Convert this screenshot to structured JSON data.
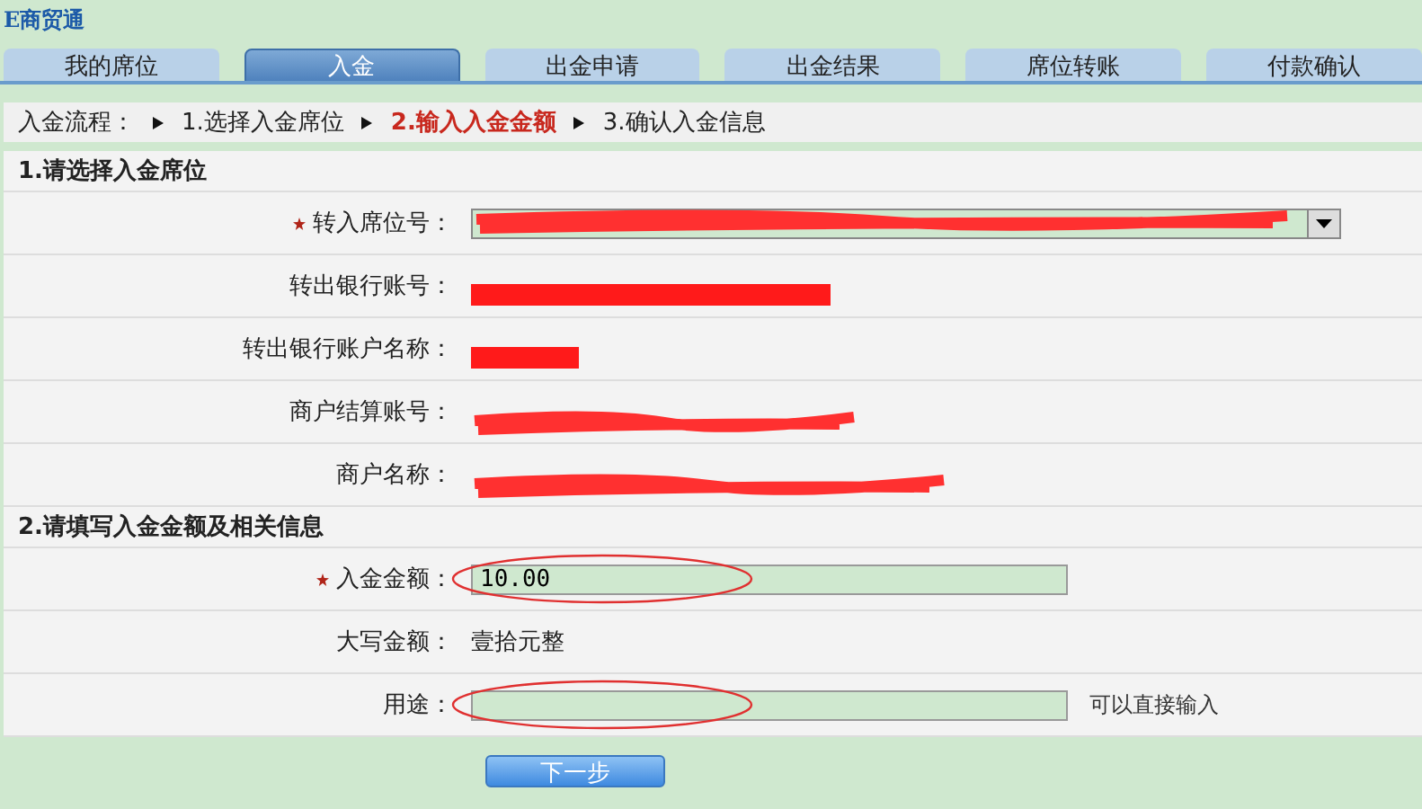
{
  "app_title": "E商贸通",
  "tabs": [
    {
      "label": "我的席位",
      "selected": false
    },
    {
      "label": "入金",
      "selected": true
    },
    {
      "label": "出金申请",
      "selected": false
    },
    {
      "label": "出金结果",
      "selected": false
    },
    {
      "label": "席位转账",
      "selected": false
    },
    {
      "label": "付款确认",
      "selected": false
    }
  ],
  "steps": {
    "label": "入金流程：",
    "items": [
      {
        "label": "1.选择入金席位",
        "selected": false
      },
      {
        "label": "2.输入入金金额",
        "selected": true
      },
      {
        "label": "3.确认入金信息",
        "selected": false
      }
    ]
  },
  "sections": [
    {
      "title": "1.请选择入金席位",
      "rows": [
        {
          "kind": "select",
          "label": "转入席位号：",
          "required": true,
          "redacted": true
        },
        {
          "kind": "text",
          "label": "转出银行账号：",
          "required": false,
          "redacted": true
        },
        {
          "kind": "text",
          "label": "转出银行账户名称：",
          "required": false,
          "redacted": true
        },
        {
          "kind": "text",
          "label": "商户结算账号：",
          "required": false,
          "redacted": true
        },
        {
          "kind": "text",
          "label": "商户名称：",
          "required": false,
          "redacted": true
        }
      ]
    },
    {
      "title": "2.请填写入金金额及相关信息",
      "rows": [
        {
          "kind": "input",
          "label": "入金金额：",
          "required": true,
          "value": "10.00",
          "highlighted": true
        },
        {
          "kind": "text",
          "label": "大写金额：",
          "required": false,
          "value": "壹拾元整"
        },
        {
          "kind": "input",
          "label": "用途：",
          "required": false,
          "value": "",
          "highlighted": true,
          "hint": "可以直接输入"
        }
      ]
    }
  ],
  "next_button": "下一步"
}
